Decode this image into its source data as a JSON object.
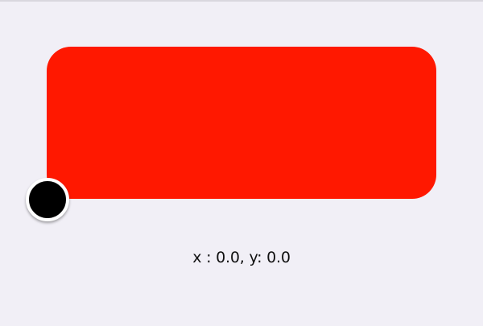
{
  "colors": {
    "background": "#F1EFF6",
    "pad": "#FF1800",
    "handle": "#000000",
    "handle_border": "#FFFFFF"
  },
  "coordinates": {
    "label": "x : 0.0, y: 0.0"
  }
}
